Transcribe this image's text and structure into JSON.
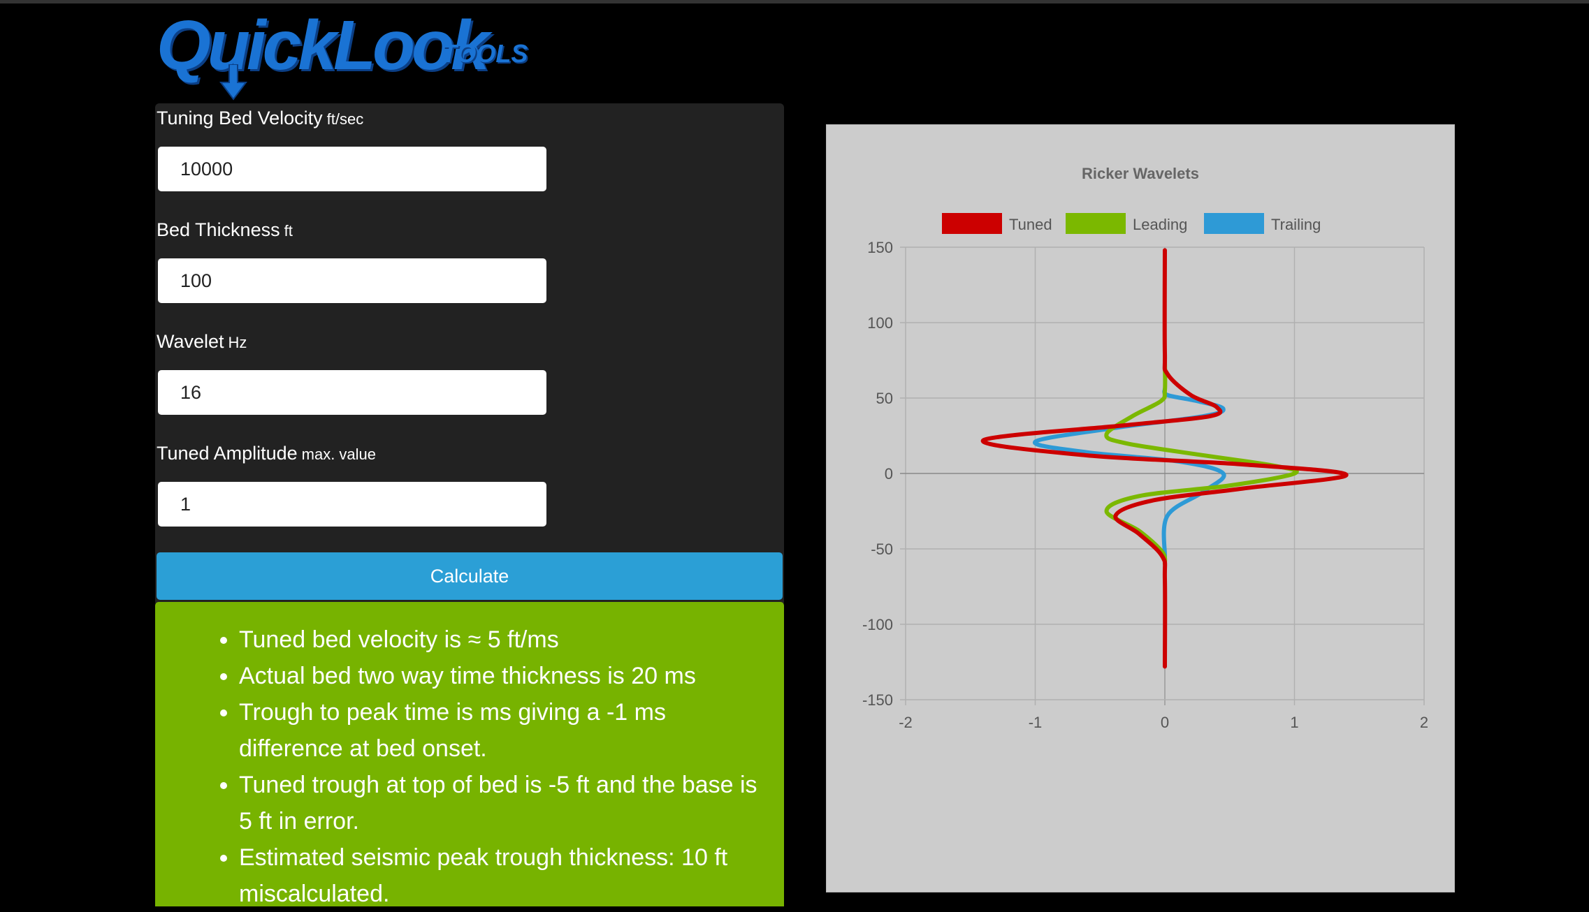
{
  "logo": {
    "text": "QuickLook",
    "suffix": "TOOLS"
  },
  "form": {
    "fields": [
      {
        "label": "Tuning Bed Velocity",
        "unit": "ft/sec",
        "value": "10000"
      },
      {
        "label": "Bed Thickness",
        "unit": "ft",
        "value": "100"
      },
      {
        "label": "Wavelet",
        "unit": "Hz",
        "value": "16"
      },
      {
        "label": "Tuned Amplitude",
        "unit": "max. value",
        "value": "1"
      }
    ],
    "button_label": "Calculate"
  },
  "results": [
    "Tuned bed velocity is ≈ 5 ft/ms",
    "Actual bed two way time thickness is 20 ms",
    "Trough to peak time is ms giving a -1 ms difference at bed onset.",
    "Tuned trough at top of bed is -5 ft and the base is 5 ft in error.",
    "Estimated seismic peak trough thickness: 10 ft miscalculated."
  ],
  "colors": {
    "form_bg": "#222222",
    "button": "#2b9fd6",
    "results_bg": "#77b300",
    "chart_bg": "#cccccc",
    "logo_blue": "#1a73d4"
  },
  "chart_data": {
    "type": "line",
    "title": "Ricker Wavelets",
    "xlabel": "",
    "ylabel": "",
    "xlim": [
      -2,
      2
    ],
    "ylim": [
      -150,
      150
    ],
    "x_ticks": [
      "-2",
      "-1",
      "0",
      "1",
      "2"
    ],
    "y_ticks": [
      "150",
      "100",
      "50",
      "0",
      "-50",
      "-100",
      "-150"
    ],
    "grid": true,
    "legend_position": "top",
    "orientation": "vertical-depth",
    "series": [
      {
        "name": "Tuned",
        "color": "#cc0000",
        "x": [
          0,
          0,
          0.02,
          0.2,
          0.4,
          0.35,
          -0.3,
          -1.4,
          -0.6,
          0.6,
          1.4,
          0.6,
          -0.1,
          -0.38,
          -0.2,
          -0.02,
          0,
          0
        ],
        "y": [
          148,
          80,
          66,
          52,
          44,
          38,
          32,
          22,
          12,
          6,
          -1,
          -10,
          -18,
          -28,
          -40,
          -55,
          -70,
          -128
        ]
      },
      {
        "name": "Leading",
        "color": "#7bb800",
        "x": [
          0,
          0,
          -0.03,
          -0.25,
          -0.45,
          -0.3,
          0.3,
          0.85,
          1.0,
          0.5,
          -0.2,
          -0.45,
          -0.2,
          -0.02,
          0
        ],
        "y": [
          75,
          55,
          48,
          38,
          26,
          20,
          12,
          5,
          0,
          -8,
          -15,
          -25,
          -38,
          -52,
          -60
        ]
      },
      {
        "name": "Trailing",
        "color": "#2e9ad6",
        "x": [
          0,
          0.02,
          0.25,
          0.45,
          0.3,
          -0.4,
          -1.0,
          -0.6,
          0.1,
          0.45,
          0.3,
          0.02,
          0
        ],
        "y": [
          56,
          52,
          48,
          43,
          38,
          30,
          21,
          14,
          8,
          0,
          -12,
          -28,
          -55
        ]
      }
    ]
  }
}
